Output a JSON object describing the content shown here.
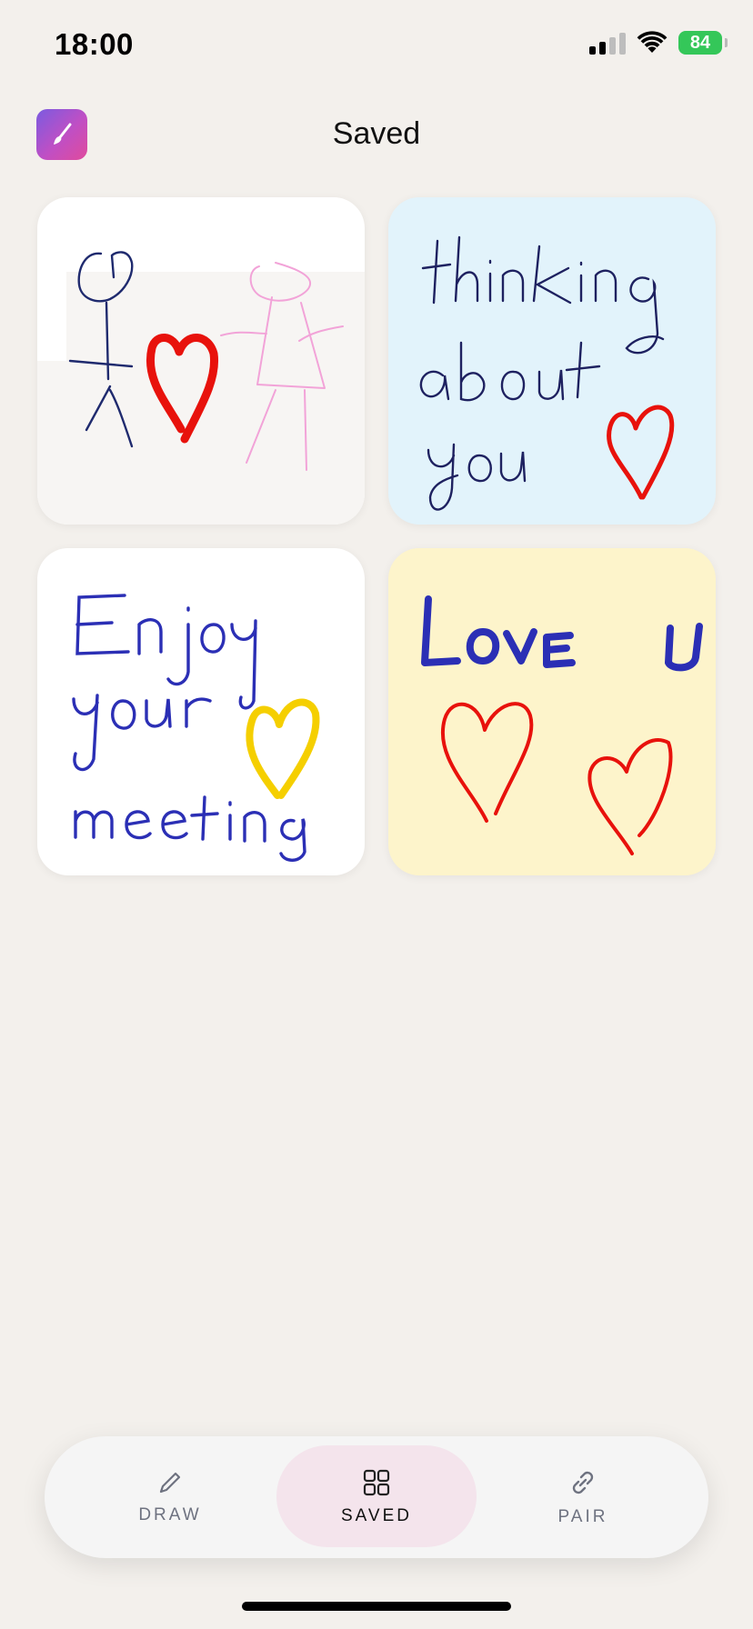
{
  "status_bar": {
    "time": "18:00",
    "battery": "84"
  },
  "header": {
    "title": "Saved",
    "app_icon": "paintbrush-icon"
  },
  "saved_drawings": [
    {
      "id_label": "drawing-1",
      "background": "#ffffff"
    },
    {
      "id_label": "drawing-2",
      "background": "#e2f3fb",
      "text": "thinking about you"
    },
    {
      "id_label": "drawing-3",
      "background": "#ffffff",
      "text": "Enjoy your meeting"
    },
    {
      "id_label": "drawing-4",
      "background": "#fdf4cb",
      "text": "Love U"
    }
  ],
  "tab_bar": {
    "tabs": [
      {
        "label": "DRAW",
        "icon": "pencil-icon",
        "active": false
      },
      {
        "label": "SAVED",
        "icon": "grid-icon",
        "active": true
      },
      {
        "label": "PAIR",
        "icon": "link-icon",
        "active": false
      }
    ]
  },
  "colors": {
    "background": "#f3f0ec",
    "active_tab": "#f4e4ec",
    "ink_blue": "#2b2fb5",
    "heart_red": "#e8120c",
    "heart_yellow": "#f5cf00",
    "figure_pink": "#f2a3d8"
  }
}
